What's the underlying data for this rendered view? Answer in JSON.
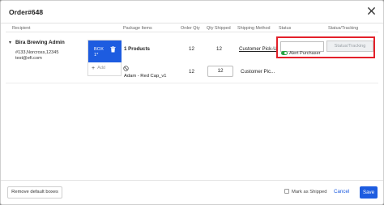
{
  "modal": {
    "title": "Order#648"
  },
  "columns": {
    "recipient": "Recipient",
    "package_items": "Package Items",
    "order_qty": "Order Qty",
    "qty_shipped": "Qty Shipped",
    "shipping_method": "Shipping Method",
    "status": "Status",
    "status_tracking": "Status/Tracking"
  },
  "recipient": {
    "name": "Bira Brewing Admin",
    "address": "#133,Norcross,12345",
    "email": "test@efi.com"
  },
  "box": {
    "label_line1": "BOX",
    "label_line2": "1*",
    "add_label": "Add"
  },
  "rows": [
    {
      "item": "1 Products",
      "order_qty": "12",
      "qty_shipped": "12",
      "shipping_method": "Customer Pick-U"
    },
    {
      "item": "Adam - Red Cap_v1",
      "order_qty": "12",
      "qty_shipped": "12",
      "shipping_method": "Customer Pic..."
    }
  ],
  "status": {
    "input_value": "",
    "tracking_button": "Status/Tracking",
    "alert_label": "Alert Purchaser"
  },
  "footer": {
    "remove_defaults": "Remove default boxes",
    "mark_shipped": "Mark as Shipped",
    "cancel": "Cancel",
    "save": "Save"
  },
  "colors": {
    "accent": "#1d5ce0",
    "highlight": "#e3202a",
    "toggle_on": "#27a243"
  }
}
